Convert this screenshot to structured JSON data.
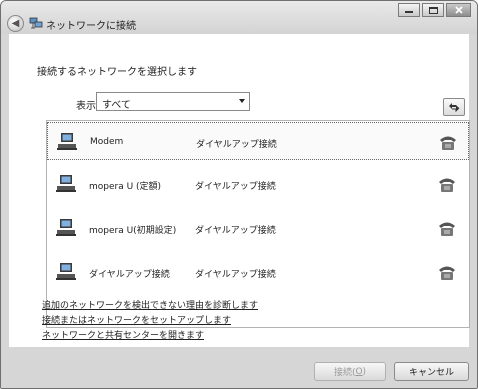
{
  "window": {
    "title": "ネットワークに接続"
  },
  "heading": "接続するネットワークを選択します",
  "filter": {
    "label": "表示",
    "value": "すべて"
  },
  "connections": [
    {
      "name": "Modem",
      "type": "ダイヤルアップ接続",
      "selected": true,
      "icon": "network-computer-icon",
      "status_icon": "phone-icon"
    },
    {
      "name": "mopera U (定額)",
      "type": "ダイヤルアップ接続",
      "selected": false,
      "icon": "network-computer-icon",
      "status_icon": "phone-icon"
    },
    {
      "name": "mopera U(初期設定)",
      "type": "ダイヤルアップ接続",
      "selected": false,
      "icon": "network-computer-icon",
      "status_icon": "phone-icon"
    },
    {
      "name": "ダイヤルアップ接続",
      "type": "ダイヤルアップ接続",
      "selected": false,
      "icon": "network-computer-icon",
      "status_icon": "phone-icon"
    }
  ],
  "links": [
    "追加のネットワークを検出できない理由を診断します",
    "接続またはネットワークをセットアップします",
    "ネットワークと共有センターを開きます"
  ],
  "buttons": {
    "connect": "接続(",
    "connect_key": "O",
    "connect_end": ")",
    "cancel": "キャンセル"
  },
  "colors": {
    "window_frame": "#d6d6d6",
    "content_bg": "#ffffff",
    "disabled_text": "#9a9a9a"
  }
}
